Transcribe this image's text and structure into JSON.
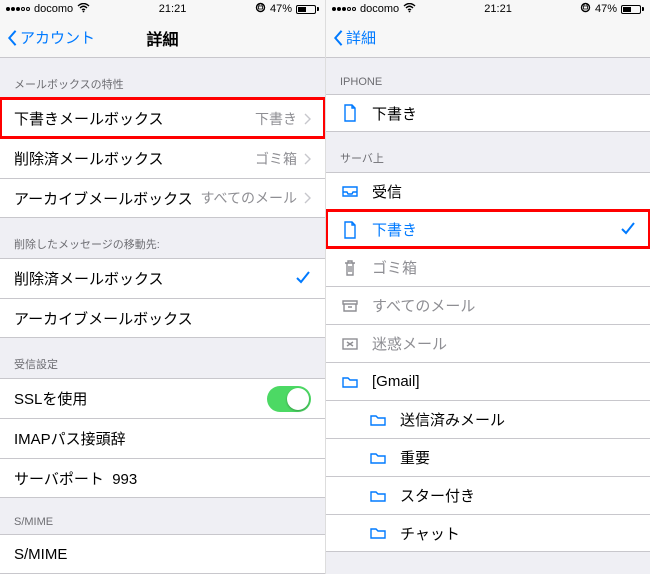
{
  "left": {
    "status": {
      "carrier": "docomo",
      "time": "21:21",
      "battery_pct": "47%"
    },
    "nav": {
      "back": "アカウント",
      "title": "詳細"
    },
    "mailbox_props_header": "メールボックスの特性",
    "rows": {
      "drafts": {
        "label": "下書きメールボックス",
        "value": "下書き"
      },
      "deleted": {
        "label": "削除済メールボックス",
        "value": "ゴミ箱"
      },
      "archive": {
        "label": "アーカイブメールボックス",
        "value": "すべてのメール"
      }
    },
    "move_header": "削除したメッセージの移動先:",
    "move": {
      "deleted": "削除済メールボックス",
      "archive": "アーカイブメールボックス"
    },
    "recv_header": "受信設定",
    "ssl": "SSLを使用",
    "imap_prefix": "IMAPパス接頭辞",
    "server_port_label": "サーバポート",
    "server_port_value": "993",
    "smime_header": "S/MIME",
    "smime_row": "S/MIME"
  },
  "right": {
    "status": {
      "carrier": "docomo",
      "time": "21:21",
      "battery_pct": "47%"
    },
    "nav": {
      "back": "詳細"
    },
    "iphone_header": "IPHONE",
    "iphone_drafts": "下書き",
    "server_header": "サーバ上",
    "folders": {
      "inbox": "受信",
      "drafts": "下書き",
      "trash": "ゴミ箱",
      "allmail": "すべてのメール",
      "spam": "迷惑メール",
      "gmail": "[Gmail]",
      "sent": "送信済みメール",
      "important": "重要",
      "starred": "スター付き",
      "chat": "チャット"
    }
  }
}
